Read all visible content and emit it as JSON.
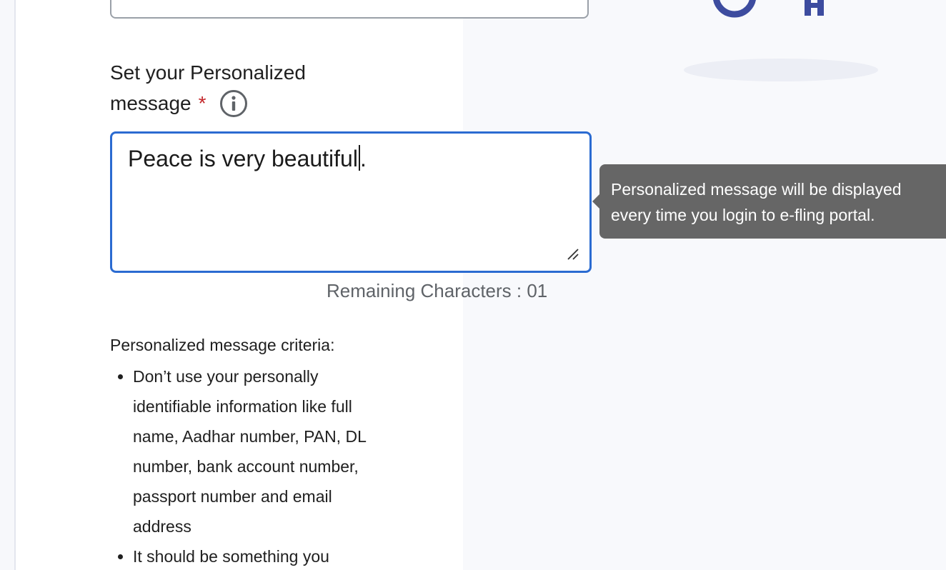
{
  "form": {
    "label_line1": "Set your Personalized",
    "label_line2": "message",
    "required_mark": "*",
    "textarea_value": "Peace is very beautiful.",
    "remaining_text": "Remaining Characters : 01"
  },
  "tooltip": {
    "text_line1": "Personalized message will be displayed",
    "text_line2": "every time you login to e-fling portal."
  },
  "criteria": {
    "title": "Personalized message criteria:",
    "items": [
      "Don’t use your personally identifiable information like full name, Aadhar number, PAN, DL number, bank account number, passport number and email address",
      "It should be something you"
    ]
  },
  "colors": {
    "focus_border": "#2b6bd1",
    "required": "#c3272b",
    "tooltip_bg": "#666666",
    "illustration": "#3d4c9f"
  },
  "icons": [
    "info-icon",
    "chevron-down-icon",
    "resize-handle-icon"
  ]
}
